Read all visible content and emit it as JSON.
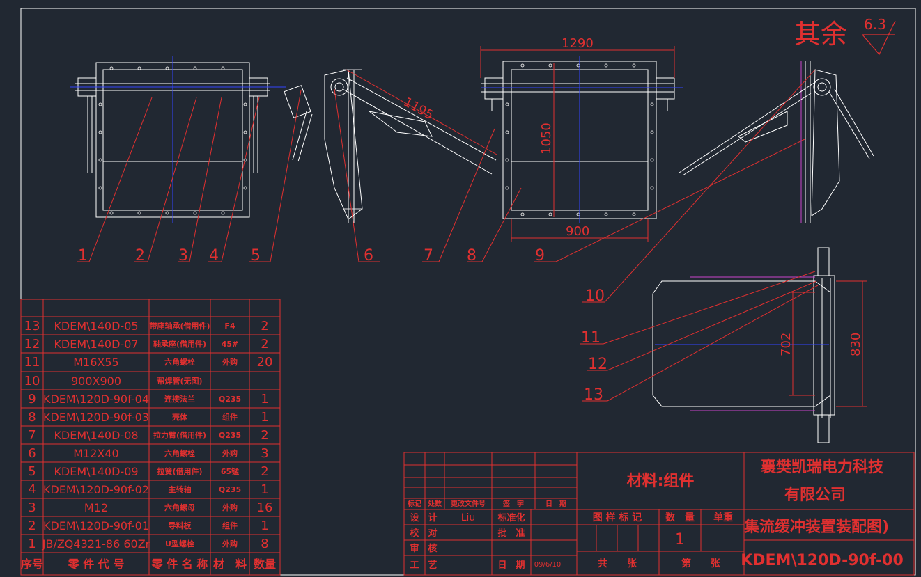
{
  "roughness": {
    "label": "其余",
    "value": "6.3"
  },
  "dimensions": {
    "d1290": "1290",
    "d1195": "1195",
    "d1050": "1050",
    "d900": "900",
    "d702": "702",
    "d830": "830"
  },
  "balloons": [
    "1",
    "2",
    "3",
    "4",
    "5",
    "6",
    "7",
    "8",
    "9",
    "10",
    "11",
    "12",
    "13"
  ],
  "bom": {
    "headers": [
      "序号",
      "零 件 代 号",
      "零 件 名 称",
      "材　料",
      "数量"
    ],
    "rows": [
      {
        "no": "13",
        "code": "KDEM\\140D-05",
        "name": "带座轴承(借用件)",
        "material": "F4",
        "qty": "2"
      },
      {
        "no": "12",
        "code": "KDEM\\140D-07",
        "name": "轴承座(借用件)",
        "material": "45#",
        "qty": "2"
      },
      {
        "no": "11",
        "code": "M16X55",
        "name": "六角螺栓",
        "material": "外购",
        "qty": "20"
      },
      {
        "no": "10",
        "code": "900X900",
        "name": "帮焊管(无图)",
        "material": "",
        "qty": ""
      },
      {
        "no": "9",
        "code": "KDEM\\120D-90f-04",
        "name": "连接法兰",
        "material": "Q235",
        "qty": "1"
      },
      {
        "no": "8",
        "code": "KDEM\\120D-90f-03",
        "name": "壳体",
        "material": "组件",
        "qty": "1"
      },
      {
        "no": "7",
        "code": "KDEM\\140D-08",
        "name": "拉力臂(借用件)",
        "material": "Q235",
        "qty": "2"
      },
      {
        "no": "6",
        "code": "M12X40",
        "name": "六角螺栓",
        "material": "外购",
        "qty": "3"
      },
      {
        "no": "5",
        "code": "KDEM\\140D-09",
        "name": "拉簧(借用件)",
        "material": "65锰",
        "qty": "2"
      },
      {
        "no": "4",
        "code": "KDEM\\120D-90f-02",
        "name": "主转轴",
        "material": "Q235",
        "qty": "1"
      },
      {
        "no": "3",
        "code": "M12",
        "name": "六角螺母",
        "material": "外购",
        "qty": "16"
      },
      {
        "no": "2",
        "code": "KDEM\\120D-90f-01",
        "name": "导料板",
        "material": "组件",
        "qty": "1"
      },
      {
        "no": "1",
        "code": "JB/ZQ4321-86  60Zr",
        "name": "U型螺栓",
        "material": "外购",
        "qty": "8"
      }
    ]
  },
  "title_block": {
    "rev_headers": [
      "标记",
      "处数",
      "更改文件号",
      "签　字",
      "日　期"
    ],
    "roles": [
      "设　计",
      "校　对",
      "审　核",
      "工　艺"
    ],
    "designer": "Liu",
    "std_label": "标准化",
    "approve_label": "批　准",
    "date_label": "日　期",
    "date": "09/6/10",
    "material": "材料:组件",
    "company_line1": "襄樊凯瑞电力科技",
    "company_line2": "有限公司",
    "drawing_name": "集流缓冲装置装配图)",
    "drawing_no": "KDEM\\120D-90f-00",
    "stage_label": "图 样 标 记",
    "qty_label": "数　量",
    "weight_label": "单重",
    "qty_value": "1",
    "sheet_total_label": "共　　张",
    "sheet_no_label": "第　　张"
  }
}
